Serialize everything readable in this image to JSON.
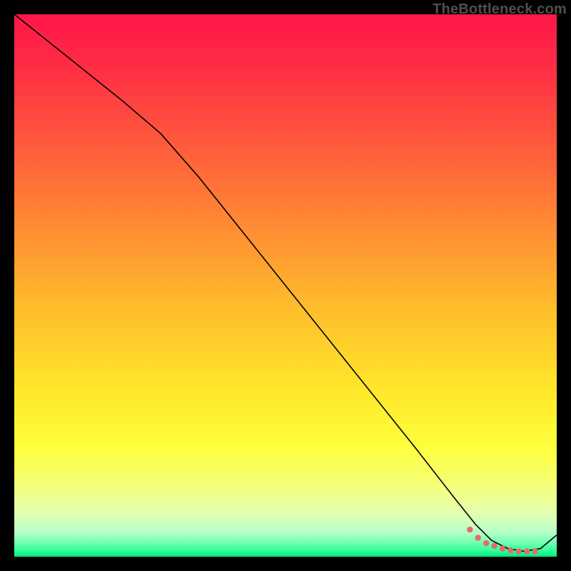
{
  "watermark": "TheBottleneck.com",
  "gradient_stops": [
    {
      "offset": 0.0,
      "color": "#ff1649"
    },
    {
      "offset": 0.1,
      "color": "#ff2e44"
    },
    {
      "offset": 0.25,
      "color": "#ff5d3b"
    },
    {
      "offset": 0.4,
      "color": "#ff8e33"
    },
    {
      "offset": 0.55,
      "color": "#ffbf2c"
    },
    {
      "offset": 0.7,
      "color": "#ffe92a"
    },
    {
      "offset": 0.8,
      "color": "#fdff3e"
    },
    {
      "offset": 0.87,
      "color": "#f4ff7a"
    },
    {
      "offset": 0.92,
      "color": "#e3ffb0"
    },
    {
      "offset": 0.955,
      "color": "#b6ffc8"
    },
    {
      "offset": 0.975,
      "color": "#6dffb0"
    },
    {
      "offset": 0.99,
      "color": "#2bff96"
    },
    {
      "offset": 1.0,
      "color": "#00e57a"
    }
  ],
  "chart_data": {
    "type": "line",
    "title": "",
    "xlabel": "",
    "ylabel": "",
    "xlim": [
      0,
      100
    ],
    "ylim": [
      0,
      100
    ],
    "grid": false,
    "series": [
      {
        "name": "curve",
        "stroke": "#000000",
        "stroke_width": 1.6,
        "x": [
          0,
          10,
          20,
          27,
          34,
          42,
          50,
          58,
          66,
          74,
          81,
          85,
          88,
          91,
          94,
          97,
          100
        ],
        "y": [
          100,
          92,
          84,
          78,
          70,
          60,
          50,
          40,
          30,
          20,
          11,
          6,
          3,
          1.5,
          1,
          1.5,
          4
        ]
      }
    ],
    "dotted_segment": {
      "name": "bottom-dots",
      "color": "#e66a6a",
      "radius": 4.2,
      "x": [
        84,
        85.5,
        87,
        88.5,
        90,
        91.5,
        93,
        94.5,
        96
      ],
      "y": [
        5,
        3.5,
        2.5,
        2,
        1.5,
        1.2,
        1,
        1,
        1
      ]
    }
  }
}
